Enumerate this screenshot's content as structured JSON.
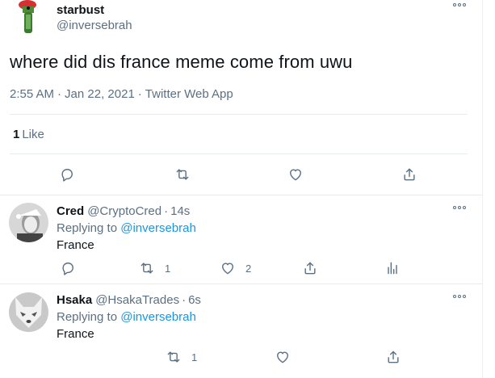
{
  "main_tweet": {
    "author_name": "starbust",
    "author_handle": "@inversebrah",
    "text": "where did dis france meme come from uwu",
    "time": "2:55 AM",
    "date": "Jan 22, 2021",
    "source": "Twitter Web App",
    "separator": "·",
    "likes_count": "1",
    "likes_label": "Like"
  },
  "replies": [
    {
      "name": "Cred",
      "handle": "@CryptoCred",
      "dot": "·",
      "time": "14s",
      "replying_prefix": "Replying to",
      "replying_to": "@inversebrah",
      "text": "France",
      "retweets": "1",
      "likes": "2"
    },
    {
      "name": "Hsaka",
      "handle": "@HsakaTrades",
      "dot": "·",
      "time": "6s",
      "replying_prefix": "Replying to",
      "replying_to": "@inversebrah",
      "text": "France",
      "retweets": "1",
      "likes": ""
    }
  ],
  "colors": {
    "text": "#0f1419",
    "secondary": "#5b7083",
    "link": "#1b95e0",
    "divider": "#e6ecf0"
  },
  "icons": [
    "reply-icon",
    "retweet-icon",
    "like-icon",
    "share-icon",
    "analytics-icon",
    "more-icon"
  ]
}
